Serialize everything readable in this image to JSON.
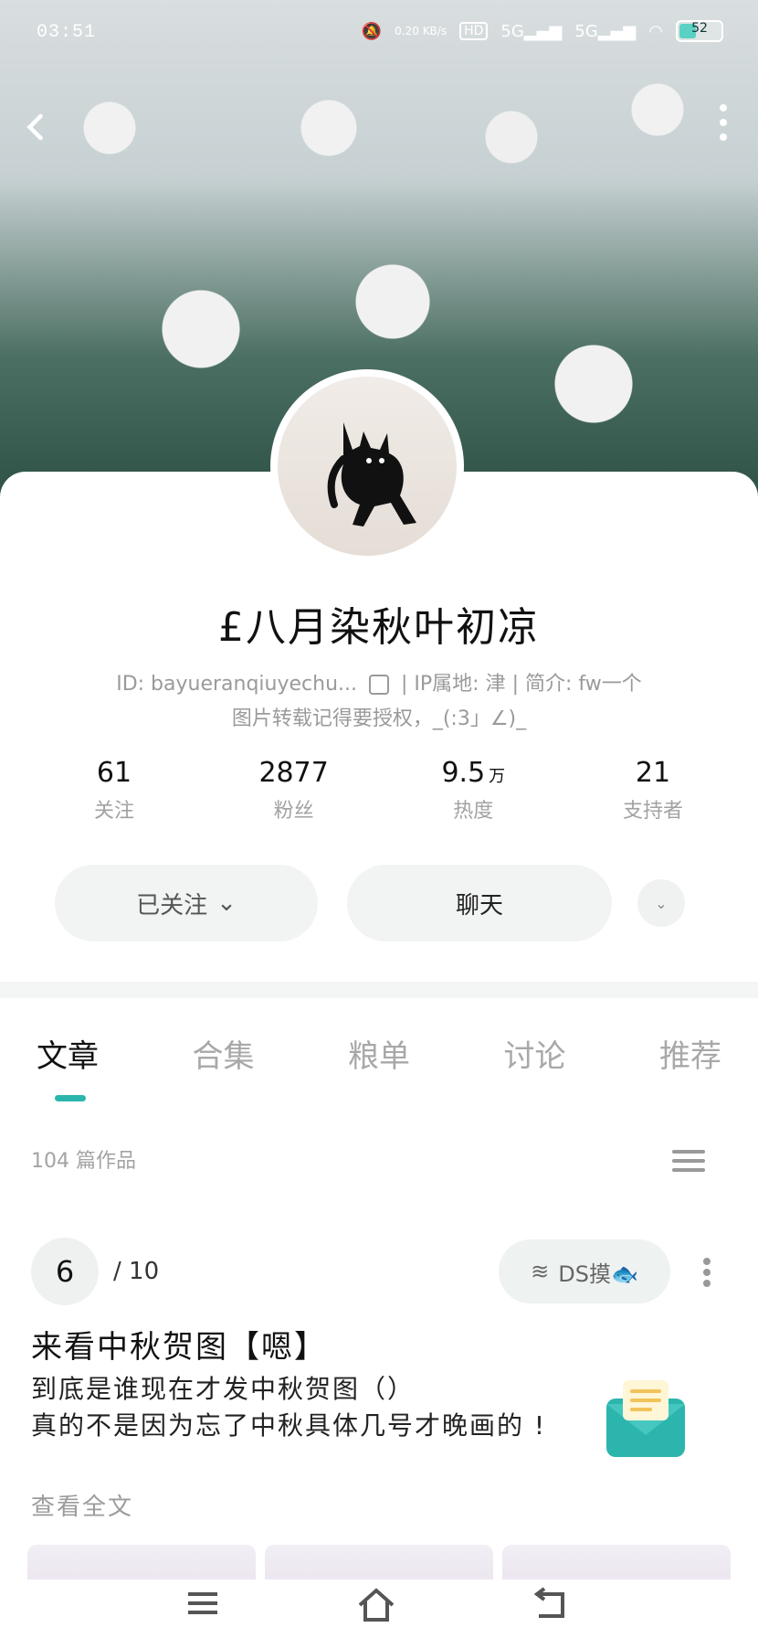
{
  "status_bar": {
    "time": "03:51",
    "icons": [
      "mute-icon",
      "hd-icon",
      "5g-signal-icon",
      "5g-signal-icon",
      "wifi-icon"
    ],
    "network_speed": "0.20 KB/s",
    "battery": "52"
  },
  "profile": {
    "username": "£八月染秋叶初凉",
    "id_line": "ID: bayueranqiuyechu...",
    "ip_label": "IP属地: 津",
    "intro_line1": "简介: fw一个",
    "intro_line2": "图片转载记得要授权，_(:3」∠)_"
  },
  "stats": [
    {
      "num": "61",
      "unit": "",
      "label": "关注"
    },
    {
      "num": "2877",
      "unit": "",
      "label": "粉丝"
    },
    {
      "num": "9.5",
      "unit": "万",
      "label": "热度"
    },
    {
      "num": "21",
      "unit": "",
      "label": "支持者"
    }
  ],
  "actions": {
    "follow": "已关注",
    "chat": "聊天"
  },
  "tabs": [
    "文章",
    "合集",
    "粮单",
    "讨论",
    "推荐"
  ],
  "works": {
    "count_text": "104 篇作品",
    "page_current": "6",
    "page_total": "/ 10",
    "category_pill": "DS摸🐟",
    "post_title": "来看中秋贺图【嗯】",
    "post_line1": "到底是谁现在才发中秋贺图（）",
    "post_line2": "真的不是因为忘了中秋具体几号才晚画的 !",
    "read_more": "查看全文"
  },
  "colors": {
    "accent": "#2bb5ad",
    "muted": "#a3a3a3"
  }
}
